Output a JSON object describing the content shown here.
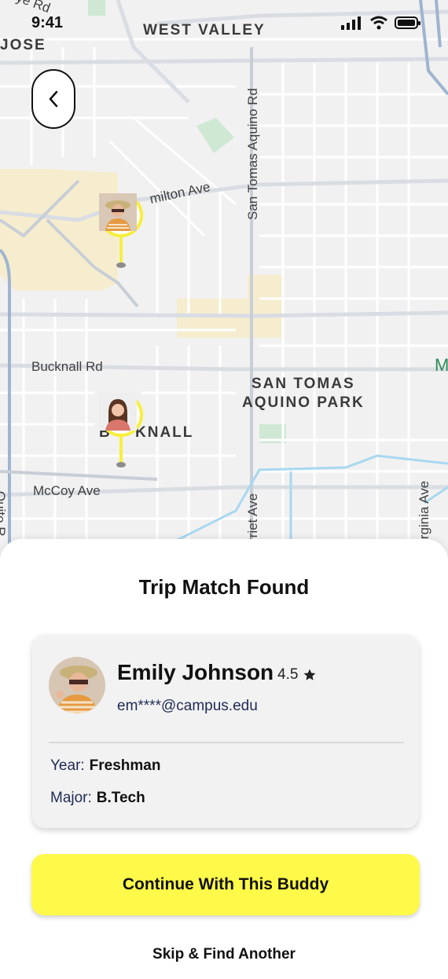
{
  "status_bar": {
    "time": "9:41"
  },
  "map": {
    "area_labels": [
      "WEST VALLEY",
      "JOSE",
      "SAN TOMAS",
      "AQUINO PARK",
      "B",
      "KNALL"
    ],
    "road_labels": {
      "top_left": "ye Rd",
      "hamilton": "milton Ave",
      "san_tomas_aquino": "San Tomas Aquino Rd",
      "bucknall": "Bucknall Rd",
      "mccoy": "McCoy Ave",
      "quito": "Quito R",
      "harriet": "rriet Ave",
      "virginia": "irginia Ave",
      "edge": "M"
    },
    "colors": {
      "road": "#ffffff",
      "major_road": "#9fb4cf",
      "park": "#cfe8d4",
      "sand": "#f6edcf",
      "water": "#a8d8f0"
    }
  },
  "back_button": {
    "icon": "chevron-left-icon"
  },
  "pins": [
    {
      "name": "Emily Johnson pin",
      "icon": "user-avatar"
    },
    {
      "name": "second user pin",
      "icon": "user-avatar"
    }
  ],
  "sheet": {
    "title": "Trip Match Found",
    "profile": {
      "name": "Emily Johnson",
      "rating": "4.5",
      "rating_icon": "star-icon",
      "email": "em****@campus.edu",
      "year_label": "Year:",
      "year_value": "Freshman",
      "major_label": "Major:",
      "major_value": "B.Tech"
    },
    "primary_button": "Continue With This Buddy",
    "secondary_button": "Skip & Find Another"
  },
  "accent_color": "#fff94a"
}
